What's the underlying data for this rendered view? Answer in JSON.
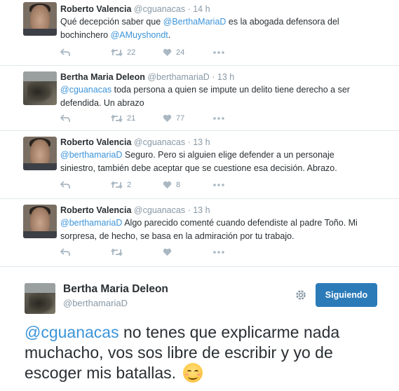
{
  "thread": [
    {
      "name": "Roberto Valencia",
      "handle": "@cguanacas",
      "dot": "·",
      "time": "14 h",
      "text_parts": [
        {
          "t": "Qué decepción saber que ",
          "mention": false
        },
        {
          "t": "@BerthaMariaD",
          "mention": true
        },
        {
          "t": " es la abogada defensora del bochinchero ",
          "mention": false
        },
        {
          "t": "@AMuyshondt",
          "mention": true
        },
        {
          "t": ".",
          "mention": false
        }
      ],
      "retweets": "22",
      "likes": "24"
    },
    {
      "name": "Bertha Maria Deleon",
      "handle": "@berthamariaD",
      "dot": "·",
      "time": "13 h",
      "text_parts": [
        {
          "t": "@cguanacas",
          "mention": true
        },
        {
          "t": " toda persona a quien se impute un delito tiene derecho a ser defendida. Un abrazo",
          "mention": false
        }
      ],
      "retweets": "21",
      "likes": "77"
    },
    {
      "name": "Roberto Valencia",
      "handle": "@cguanacas",
      "dot": "·",
      "time": "13 h",
      "text_parts": [
        {
          "t": "@berthamariaD",
          "mention": true
        },
        {
          "t": " Seguro. Pero si alguien elige defender a un personaje siniestro, también debe aceptar que se cuestione esa decisión. Abrazo.",
          "mention": false
        }
      ],
      "retweets": "2",
      "likes": "8"
    },
    {
      "name": "Roberto Valencia",
      "handle": "@cguanacas",
      "dot": "·",
      "time": "13 h",
      "text_parts": [
        {
          "t": "@berthamariaD",
          "mention": true
        },
        {
          "t": " Algo parecido comenté cuando defendiste al padre Toño. Mi sorpresa, de hecho, se basa en la admiración por tu trabajo.",
          "mention": false
        }
      ],
      "retweets": "",
      "likes": ""
    }
  ],
  "featured": {
    "name": "Bertha Maria Deleon",
    "handle": "@berthamariaD",
    "follow_label": "Siguiendo",
    "mention": "@cguanacas",
    "text": " no tenes que explicarme nada muchacho, vos sos libre de escribir y yo de escoger mis batallas. ",
    "emoji": "smiling-face-emoji"
  },
  "colors": {
    "mention": "#3b94d9",
    "follow_button": "#2b7bb9",
    "meta": "#8899a6",
    "icon": "#aab8c2"
  },
  "icons": [
    "reply-icon",
    "retweet-icon",
    "heart-icon",
    "more-icon",
    "gear-icon"
  ]
}
